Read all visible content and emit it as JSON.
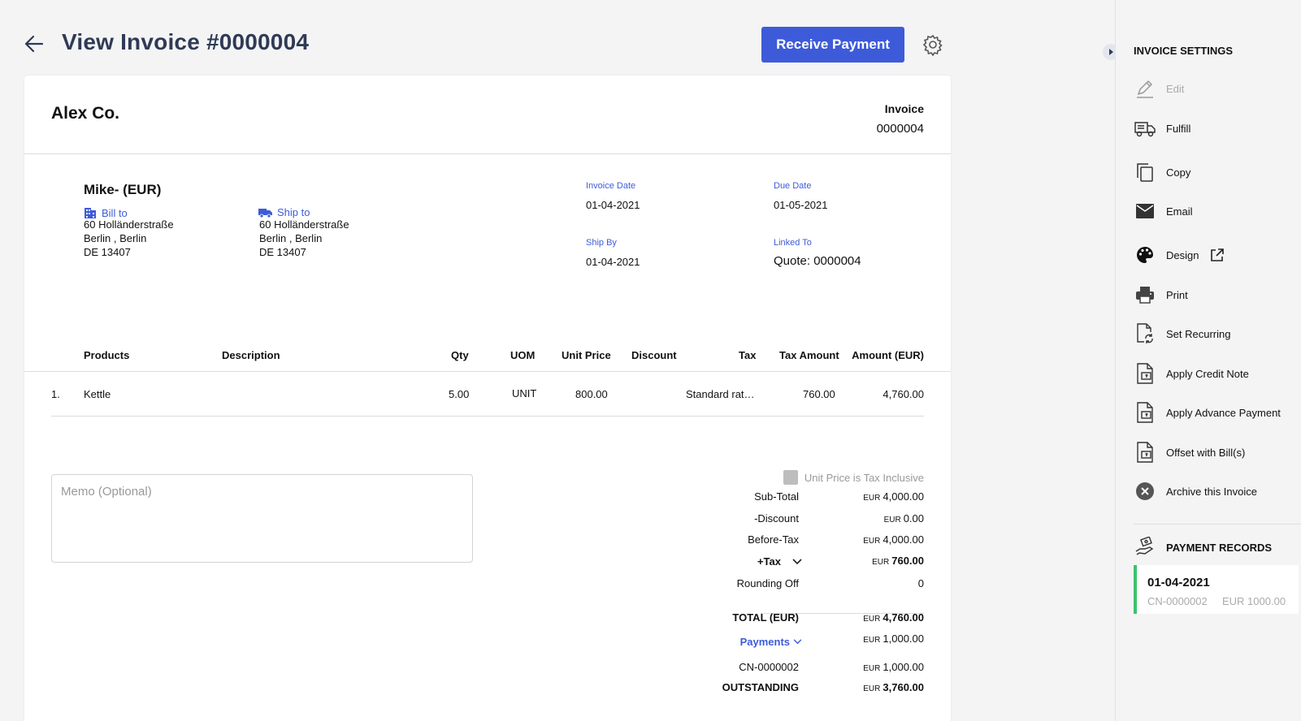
{
  "header": {
    "title": "View Invoice #0000004",
    "receive_payment_label": "Receive Payment"
  },
  "invoice": {
    "company": "Alex Co.",
    "invoice_label": "Invoice",
    "invoice_number": "0000004",
    "customer": "Mike- (EUR)",
    "bill_to": {
      "label": "Bill to",
      "lines": [
        "60 Holländerstraße",
        "Berlin , Berlin",
        "DE 13407"
      ]
    },
    "ship_to": {
      "label": "Ship to",
      "lines": [
        "60 Holländerstraße",
        "Berlin , Berlin",
        "DE 13407"
      ]
    },
    "meta": {
      "invoice_date_label": "Invoice Date",
      "invoice_date": "01-04-2021",
      "due_date_label": "Due Date",
      "due_date": "01-05-2021",
      "ship_by_label": "Ship By",
      "ship_by": "01-04-2021",
      "linked_to_label": "Linked To",
      "linked_to": "Quote: 0000004"
    },
    "table": {
      "columns": [
        "Products",
        "Description",
        "Qty",
        "UOM",
        "Unit Price",
        "Discount",
        "Tax",
        "Tax Amount",
        "Amount (EUR)"
      ],
      "rows": [
        {
          "index": "1.",
          "product": "Kettle",
          "description": "",
          "qty": "5.00",
          "uom": "UNIT",
          "unit_price": "800.00",
          "discount": "",
          "tax": "Standard rat…",
          "tax_amount": "760.00",
          "amount": "4,760.00"
        }
      ]
    },
    "memo_placeholder": "Memo (Optional)",
    "tax_inclusive_label": "Unit Price is Tax Inclusive",
    "summary": {
      "currency": "EUR",
      "subtotal_label": "Sub-Total",
      "subtotal": "4,000.00",
      "discount_label": "-Discount",
      "discount": "0.00",
      "before_tax_label": "Before-Tax",
      "before_tax": "4,000.00",
      "tax_label": "+Tax",
      "tax": "760.00",
      "rounding_label": "Rounding Off",
      "rounding": "0",
      "total_label": "TOTAL (EUR)",
      "total": "4,760.00",
      "payments_label": "Payments",
      "payments": "1,000.00",
      "credit_ref_label": "CN-0000002",
      "credit_ref": "1,000.00",
      "outstanding_label": "OUTSTANDING",
      "outstanding": "3,760.00"
    }
  },
  "side_panel": {
    "title": "INVOICE SETTINGS",
    "items": [
      {
        "label": "Edit",
        "icon": "pencil-icon"
      },
      {
        "label": "Fulfill",
        "icon": "truck-icon"
      },
      {
        "label": "Copy",
        "icon": "copy-icon"
      },
      {
        "label": "Email",
        "icon": "envelope-icon"
      },
      {
        "label": "Design",
        "icon": "palette-icon"
      },
      {
        "label": "Print",
        "icon": "printer-icon"
      },
      {
        "label": "Set Recurring",
        "icon": "recurring-icon"
      },
      {
        "label": "Apply Credit Note",
        "icon": "credit-note-icon"
      },
      {
        "label": "Apply Advance Payment",
        "icon": "advance-payment-icon"
      },
      {
        "label": "Offset with Bill(s)",
        "icon": "offset-bill-icon"
      },
      {
        "label": "Archive this Invoice",
        "icon": "archive-x-icon"
      }
    ],
    "payment_records_title": "PAYMENT RECORDS",
    "payment_records": [
      {
        "date": "01-04-2021",
        "ref": "CN-0000002",
        "amount": "EUR 1000.00"
      }
    ]
  },
  "colors": {
    "accent": "#3d5bd9",
    "title": "#2f3a55",
    "success": "#3cc36b"
  }
}
